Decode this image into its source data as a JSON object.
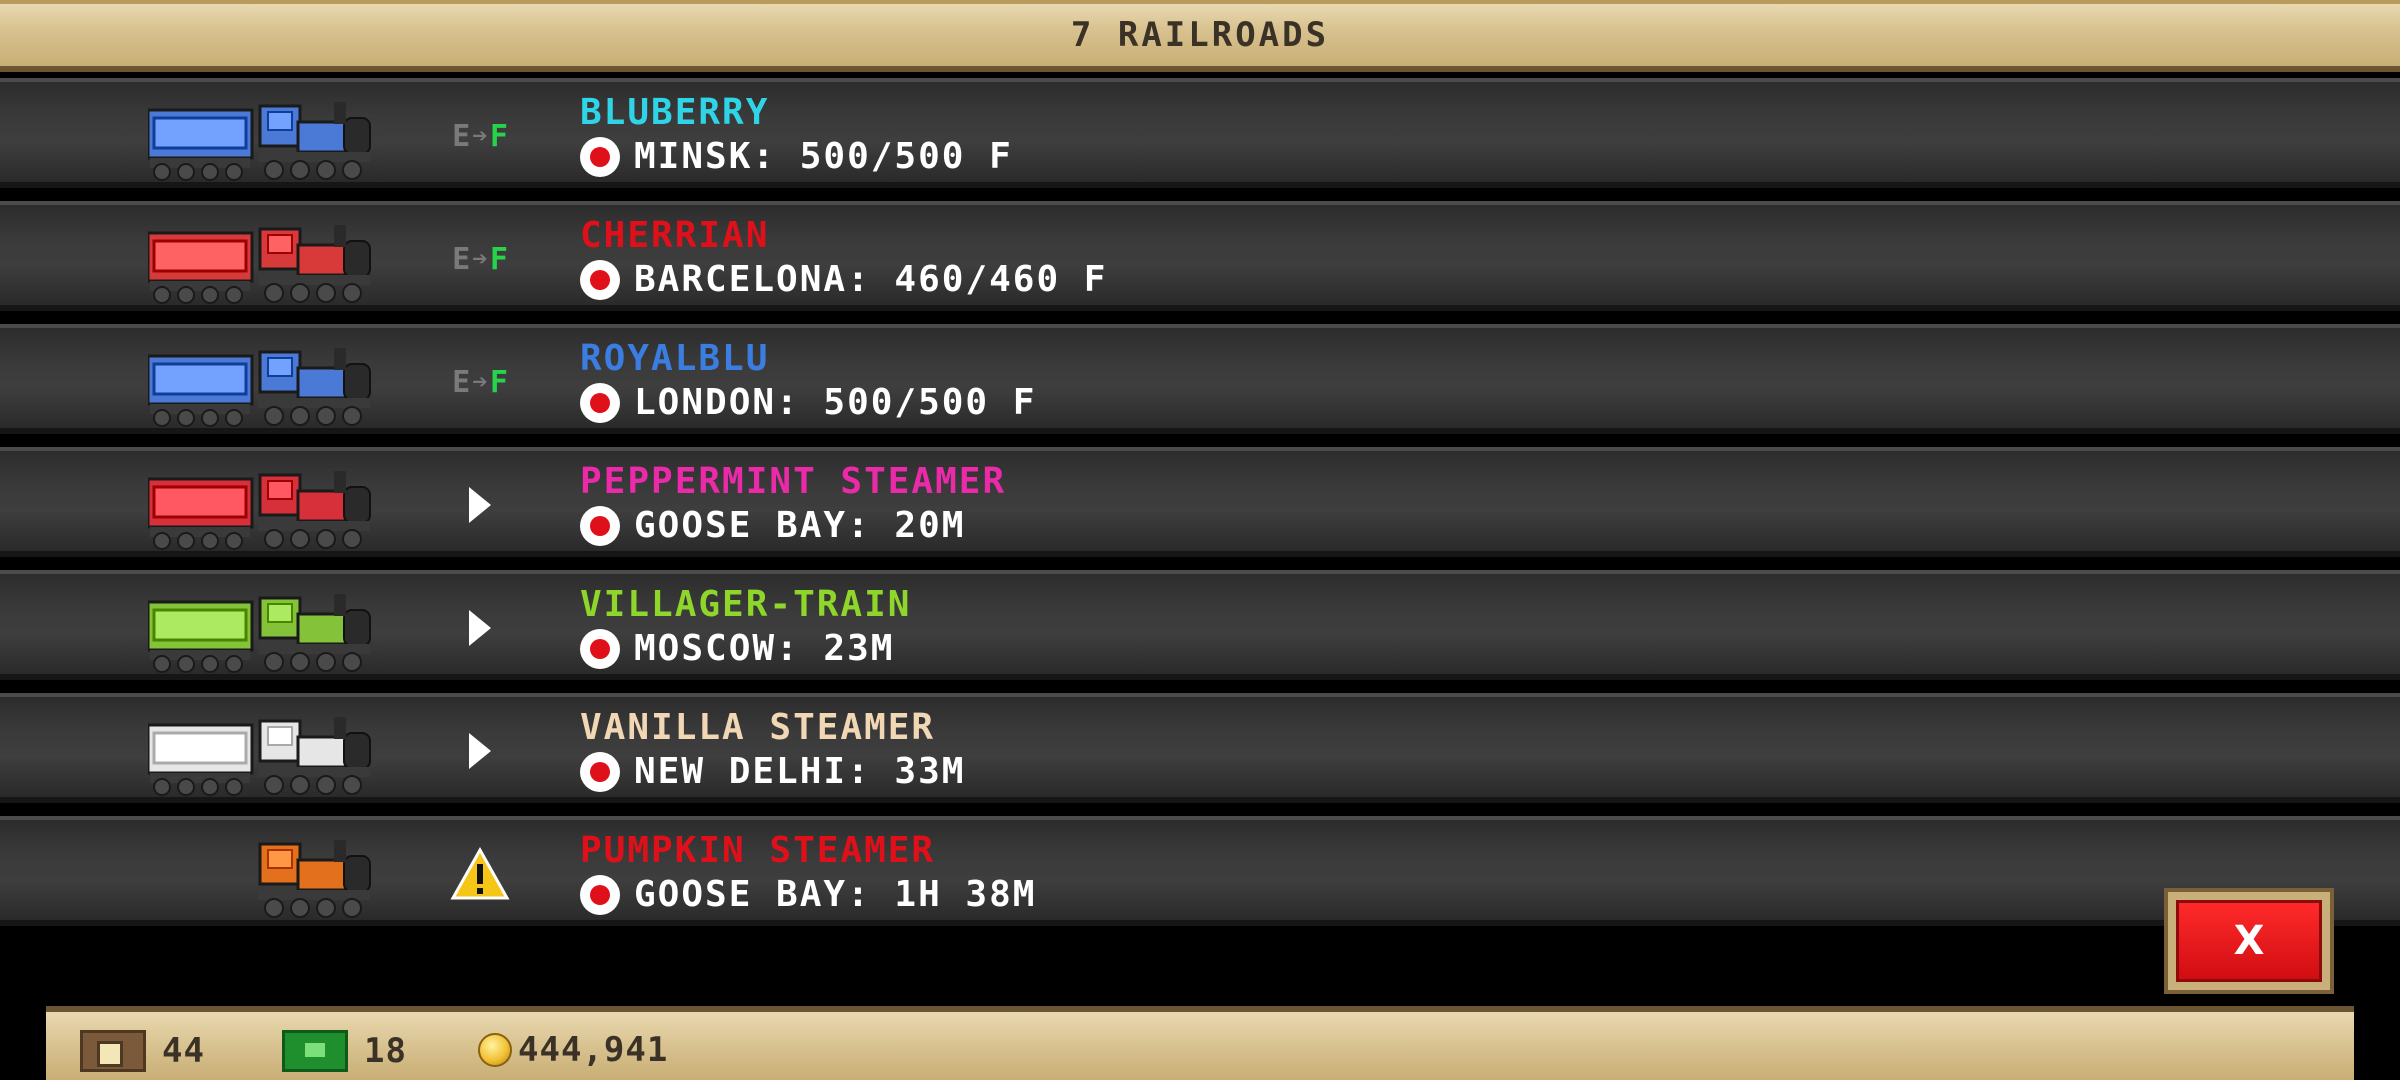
{
  "header": {
    "title": "7 RAILROADS"
  },
  "colors": {
    "blue": "#2fd5e6",
    "red": "#e0101a",
    "royal": "#3b7de0",
    "pink": "#ea2aa8",
    "green": "#8ed62a",
    "cream": "#f2d7b5",
    "orange_red": "#e0101a"
  },
  "trains": [
    {
      "name": "BLUBERRY",
      "name_color": "#2fd5e6",
      "status": "E→F",
      "destination": "MINSK: 500/500 F",
      "train_color": "#4a7ad6",
      "has_tender": true
    },
    {
      "name": "CHERRIAN",
      "name_color": "#e0101a",
      "status": "E→F",
      "destination": "BARCELONA: 460/460 F",
      "train_color": "#d83a3a",
      "has_tender": true
    },
    {
      "name": "ROYALBLU",
      "name_color": "#3b7de0",
      "status": "E→F",
      "destination": "LONDON: 500/500 F",
      "train_color": "#4a7ad6",
      "has_tender": true
    },
    {
      "name": "PEPPERMINT STEAMER",
      "name_color": "#ea2aa8",
      "status": "play",
      "destination": "GOOSE BAY: 20M",
      "train_color": "#d8303a",
      "has_tender": true
    },
    {
      "name": "VILLAGER-TRAIN",
      "name_color": "#8ed62a",
      "status": "play",
      "destination": "MOSCOW: 23M",
      "train_color": "#84c23a",
      "has_tender": true
    },
    {
      "name": "VANILLA STEAMER",
      "name_color": "#f2d7b5",
      "status": "play",
      "destination": "NEW DELHI: 33M",
      "train_color": "#e6e6e6",
      "has_tender": true
    },
    {
      "name": "PUMPKIN STEAMER",
      "name_color": "#e0101a",
      "status": "warning",
      "destination": "GOOSE BAY: 1H 38M",
      "train_color": "#e3701c",
      "has_tender": false
    }
  ],
  "close_button": {
    "label": "X"
  },
  "footer": {
    "crates": "44",
    "cash": "18",
    "coins": "444,941"
  }
}
